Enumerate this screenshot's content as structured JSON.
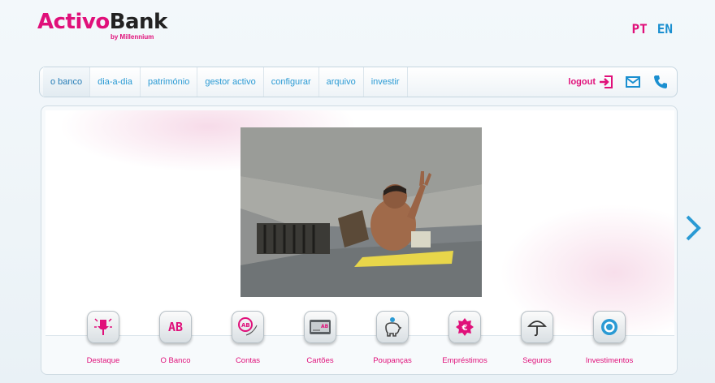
{
  "brand": {
    "name_part1": "Activo",
    "name_part2": "Bank",
    "sub": "by Millennium"
  },
  "languages": {
    "pt": "PT",
    "en": "EN"
  },
  "nav": {
    "tabs": [
      "o banco",
      "dia-a-dia",
      "património",
      "gestor activo",
      "configurar",
      "arquivo",
      "investir"
    ],
    "logout_label": "logout"
  },
  "colors": {
    "accent": "#e0107a",
    "link": "#2a9ad4"
  },
  "products": [
    {
      "label": "Destaque",
      "icon": "pushpin-icon"
    },
    {
      "label": "O Banco",
      "icon": "ab-logo-icon"
    },
    {
      "label": "Contas",
      "icon": "accounts-icon"
    },
    {
      "label": "Cartões",
      "icon": "card-icon"
    },
    {
      "label": "Poupanças",
      "icon": "piggy-bank-icon"
    },
    {
      "label": "Empréstimos",
      "icon": "loan-icon"
    },
    {
      "label": "Seguros",
      "icon": "umbrella-icon"
    },
    {
      "label": "Investimentos",
      "icon": "target-icon"
    }
  ]
}
